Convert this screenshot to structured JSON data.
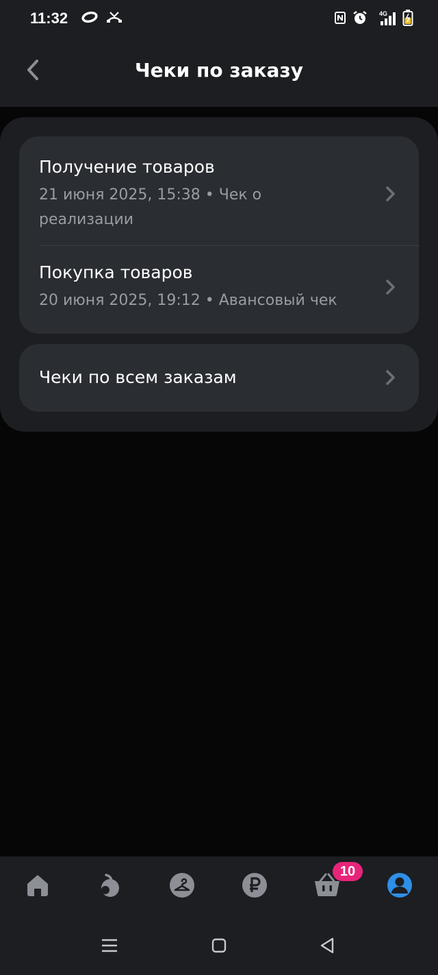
{
  "status_bar": {
    "time": "11:32",
    "left_icons": [
      "oval-ring-icon",
      "missed-call-icon"
    ],
    "right_icons": [
      "nfc-icon",
      "alarm-icon",
      "signal-4g-icon",
      "battery-charging-icon"
    ],
    "network": "4G"
  },
  "header": {
    "title": "Чеки по заказу",
    "back_icon": "chevron-left-icon"
  },
  "receipts": [
    {
      "title": "Получение товаров",
      "subtitle": "21 июня 2025, 15:38 • Чек о реализации"
    },
    {
      "title": "Покупка товаров",
      "subtitle": "20 июня 2025, 19:12 • Авансовый чек"
    }
  ],
  "all_receipts": {
    "label": "Чеки по всем заказам"
  },
  "bottom_nav": {
    "items": [
      {
        "icon": "home-icon",
        "active": false
      },
      {
        "icon": "fruit-catalog-icon",
        "active": false
      },
      {
        "icon": "hanger-icon",
        "active": false
      },
      {
        "icon": "ruble-icon",
        "active": false
      },
      {
        "icon": "basket-icon",
        "active": false
      },
      {
        "icon": "profile-icon",
        "active": true
      }
    ],
    "cart_badge": "10"
  },
  "colors": {
    "background": "#060607",
    "surface": "#1c1e22",
    "card": "#2a2d32",
    "muted_text": "#9a9ca3",
    "icon_inactive": "#8d8f96",
    "accent_active": "#2e8fe8",
    "badge": "#e8247a"
  },
  "system_nav": [
    "menu-icon",
    "home-square-icon",
    "back-triangle-icon"
  ]
}
